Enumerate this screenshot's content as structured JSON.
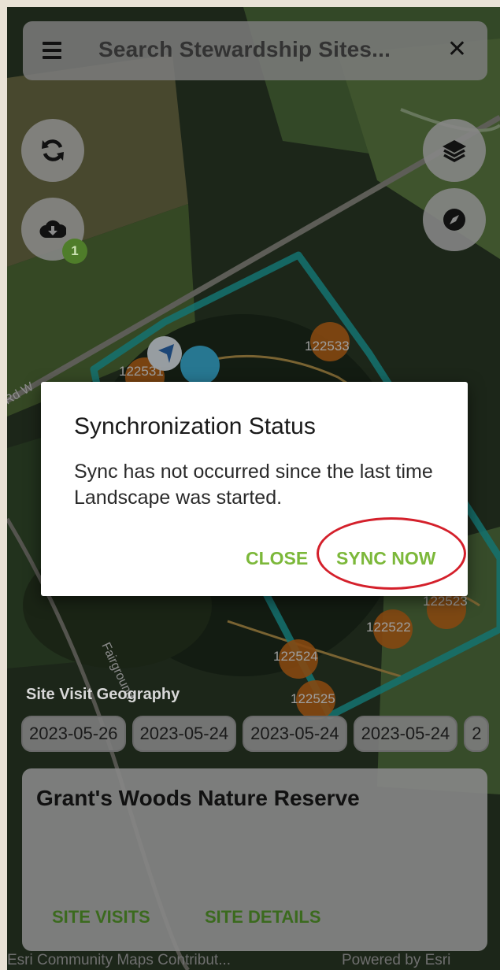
{
  "search": {
    "placeholder": "Search Stewardship Sites..."
  },
  "buttons": {
    "close_symbol": "✕",
    "download_badge": "1"
  },
  "map": {
    "road_label_left": "Rd W",
    "road_label_fair": "Fairground",
    "markers": [
      "122533",
      "122531",
      "122523",
      "122522",
      "122524",
      "122525"
    ]
  },
  "site_visit": {
    "label": "Site Visit Geography",
    "dates": [
      "2023-05-26",
      "2023-05-24",
      "2023-05-24",
      "2023-05-24",
      "2"
    ]
  },
  "site_card": {
    "title": "Grant's Woods Nature Reserve",
    "site_visits_label": "SITE VISITS",
    "site_details_label": "SITE DETAILS"
  },
  "attribution": {
    "left": "Esri Community Maps Contribut...",
    "right": "Powered by Esri"
  },
  "dialog": {
    "title": "Synchronization Status",
    "message": "Sync has not occurred since the last time Landscape was started.",
    "close_label": "CLOSE",
    "sync_label": "SYNC NOW"
  },
  "colors": {
    "accent_green": "#7cb83a",
    "card_button_green": "#3b6a1e",
    "boundary_teal": "#1fa9a6",
    "marker_orange": "#c46a1a",
    "annotation_red": "#d4202b"
  }
}
